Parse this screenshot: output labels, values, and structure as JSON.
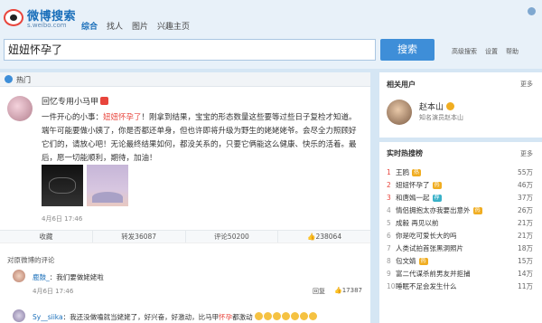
{
  "app": {
    "logo_title": "微博搜索",
    "logo_sub": "s.weibo.com"
  },
  "nav": {
    "tabs": [
      {
        "label": "综合",
        "active": true
      },
      {
        "label": "找人",
        "active": false
      },
      {
        "label": "图片",
        "active": false
      },
      {
        "label": "兴趣主页",
        "active": false
      }
    ]
  },
  "search": {
    "query": "妞妞怀孕了",
    "button_label": "搜索",
    "links": [
      "高级搜索",
      "设置",
      "帮助"
    ]
  },
  "hot_bar": {
    "label": "热门"
  },
  "post": {
    "author": "回忆专用小马甲",
    "text_before": "一件开心的小事：",
    "text_highlight": "妞妞怀孕了",
    "text_after": "！刚拿到结果，宝宝的形态数量这些要等过些日子复检才知道。端午可能要做小姨了，你是否都还单身，但也许即将升级为野生的姥姥姥爷。会尽全力照顾好它们的，请放心吧！无论最终结果如何，都没关系的，只要它俩能这么健康、快乐的活着。最后，愿一切能顺利，期待，加油！",
    "time": "4月6日 17:46",
    "actions": {
      "favorite": "收藏",
      "repost": "转发36087",
      "comment": "评论50200",
      "like": "238064"
    }
  },
  "comments": {
    "header": "对原微博的评论",
    "items": [
      {
        "user": "鹿鼓_",
        "text": "：我们要做姥姥啦",
        "time": "4月6日 17:46",
        "reply": "回复",
        "likes": "17387"
      },
      {
        "user": "Sy__siika",
        "text_before": "：我还没做嗑就当姥姥了，好兴奋，好激动，比马甲",
        "text_highlight": "怀孕",
        "text_after": "都激动"
      }
    ]
  },
  "related": {
    "title": "相关用户",
    "more": "更多",
    "user_name": "赵本山",
    "user_desc": "知名演员赵本山"
  },
  "hotlist": {
    "title": "实时热搜榜",
    "more": "更多",
    "items": [
      {
        "rank": "1",
        "text": "王鸥",
        "badge": "热",
        "badge_color": "#f0ad21",
        "count": "55万"
      },
      {
        "rank": "2",
        "text": "妞妞怀孕了",
        "badge": "热",
        "badge_color": "#f0ad21",
        "count": "46万"
      },
      {
        "rank": "3",
        "text": "和唐嫣一起",
        "badge": "荐",
        "badge_color": "#39b1c8",
        "count": "37万"
      },
      {
        "rank": "4",
        "text": "情侣拥抱太亦我要出意外",
        "badge": "热",
        "badge_color": "#f0ad21",
        "count": "26万"
      },
      {
        "rank": "5",
        "text": "成毅 再见以前",
        "badge": "",
        "badge_color": "",
        "count": "21万"
      },
      {
        "rank": "6",
        "text": "你是吃可爱长大的吗",
        "badge": "",
        "badge_color": "",
        "count": "21万"
      },
      {
        "rank": "7",
        "text": "人类试拍首张黑洞照片",
        "badge": "",
        "badge_color": "",
        "count": "18万"
      },
      {
        "rank": "8",
        "text": "包文婧",
        "badge": "热",
        "badge_color": "#f0ad21",
        "count": "15万"
      },
      {
        "rank": "9",
        "text": "富二代谋杀前男友并拒捕",
        "badge": "",
        "badge_color": "",
        "count": "14万"
      },
      {
        "rank": "10",
        "text": "睡眠不足会发生什么",
        "badge": "",
        "badge_color": "",
        "count": "11万"
      }
    ]
  }
}
